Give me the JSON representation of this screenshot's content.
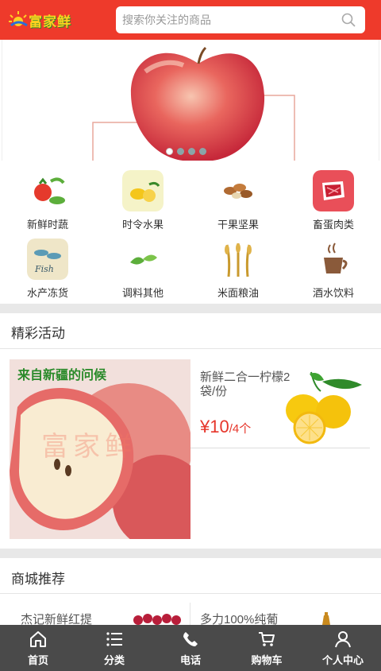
{
  "header": {
    "logo_text": "富家鲜",
    "search_placeholder": "搜索你关注的商品"
  },
  "banner": {
    "slides": 4,
    "active_slide": 1
  },
  "categories": [
    {
      "label": "新鲜时蔬",
      "icon": "vegetables-icon"
    },
    {
      "label": "时令水果",
      "icon": "fruit-icon"
    },
    {
      "label": "干果坚果",
      "icon": "nuts-icon"
    },
    {
      "label": "畜蛋肉类",
      "icon": "meat-icon"
    },
    {
      "label": "水产冻货",
      "icon": "fish-icon"
    },
    {
      "label": "调料其他",
      "icon": "seasoning-icon"
    },
    {
      "label": "米面粮油",
      "icon": "grain-icon"
    },
    {
      "label": "酒水饮料",
      "icon": "drinks-icon"
    }
  ],
  "activities": {
    "title": "精彩活动",
    "feature_caption": "来自新疆的问候",
    "feature_watermark": "富家鲜",
    "product": {
      "name": "新鲜二合一柠檬2袋/份",
      "price": "¥10",
      "unit": "/4个"
    }
  },
  "recommend": {
    "title": "商城推荐",
    "items": [
      "杰记新鲜红提",
      "多力100%纯葡"
    ]
  },
  "tabbar": [
    {
      "label": "首页",
      "icon": "home-icon"
    },
    {
      "label": "分类",
      "icon": "list-icon"
    },
    {
      "label": "电话",
      "icon": "phone-icon"
    },
    {
      "label": "购物车",
      "icon": "cart-icon"
    },
    {
      "label": "个人中心",
      "icon": "user-icon"
    }
  ],
  "colors": {
    "brand_red": "#ee3a2b",
    "price_red": "#e6352a",
    "tabbar_bg": "#4a4a4a",
    "caption_green": "#2a8a2a"
  }
}
